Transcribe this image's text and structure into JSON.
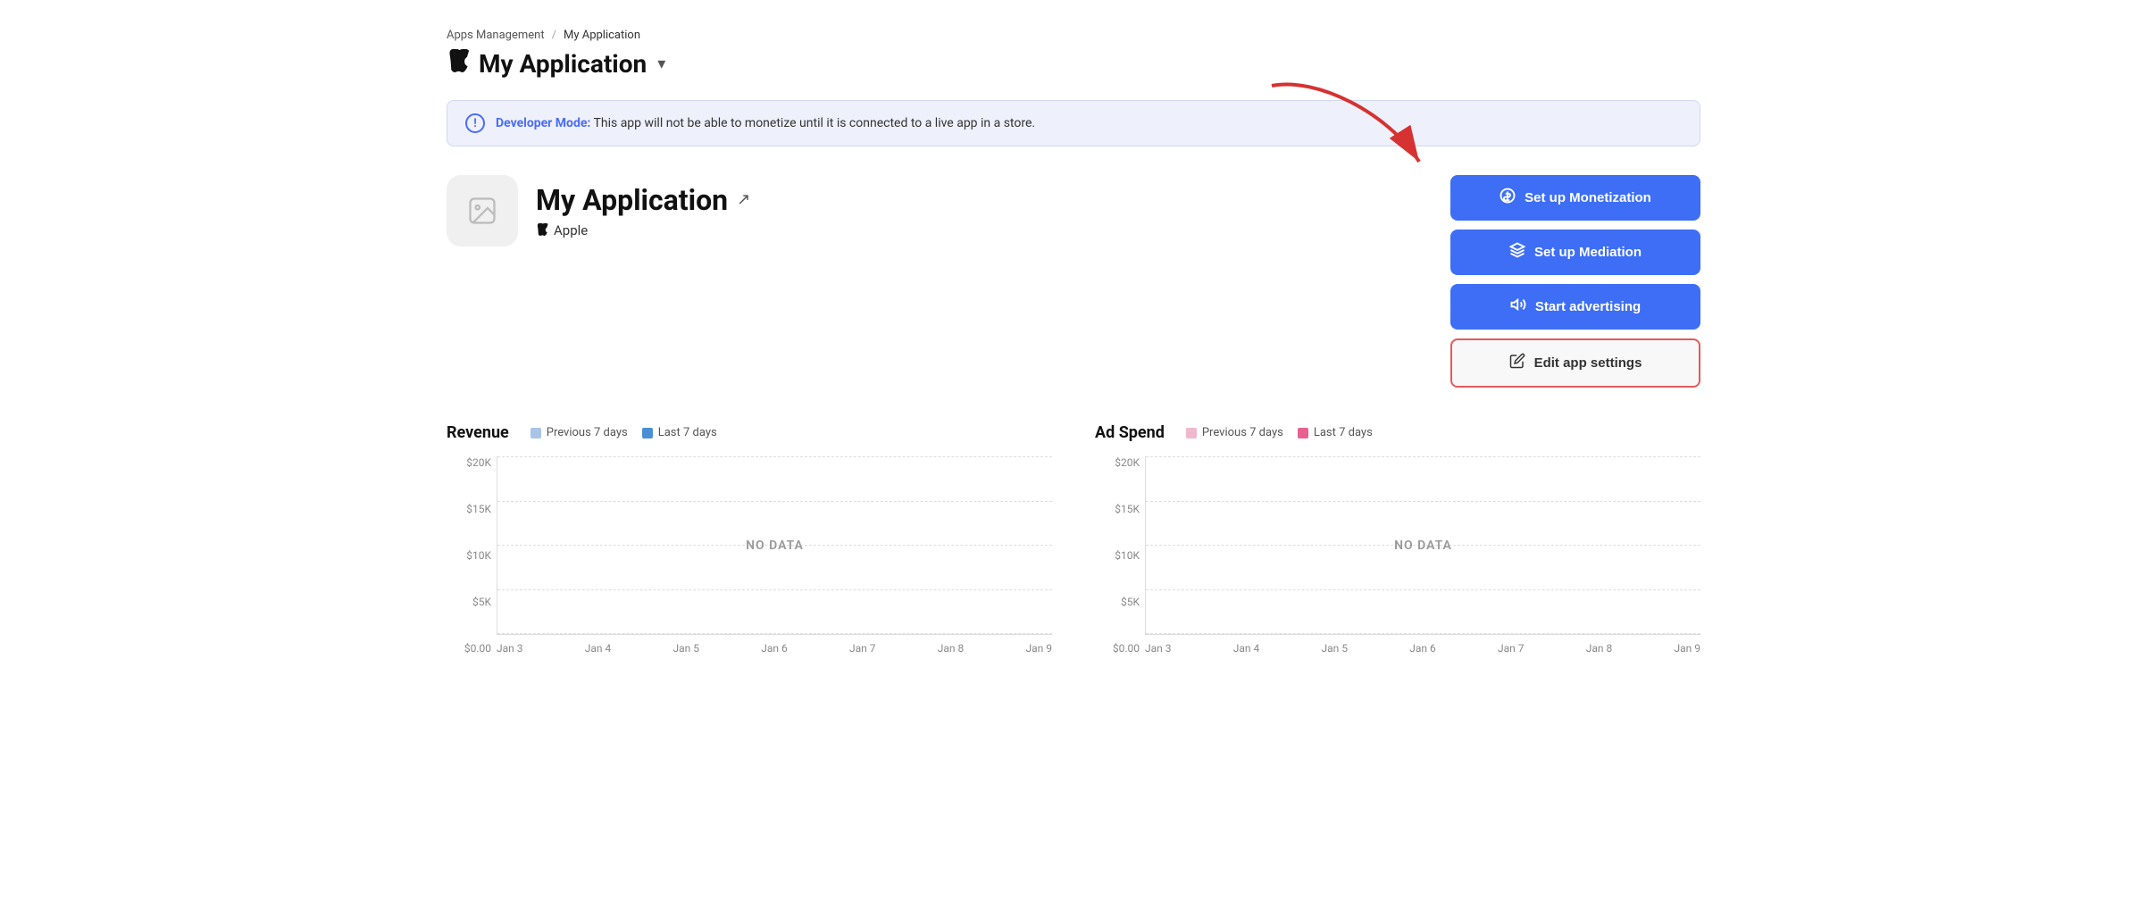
{
  "breadcrumb": {
    "parent_label": "Apps Management",
    "separator": "/",
    "current_label": "My Application"
  },
  "page_title": {
    "icon": "🍎",
    "text": "My Application",
    "chevron": "▾"
  },
  "dev_banner": {
    "icon_text": "!",
    "bold_label": "Developer Mode:",
    "message": " This app will not be able to monetize until it is connected to a live app in a store."
  },
  "app": {
    "name": "My Application",
    "store": "Apple",
    "external_link_icon": "↗"
  },
  "buttons": {
    "monetization_label": "Set up Monetization",
    "mediation_label": "Set up Mediation",
    "advertising_label": "Start advertising",
    "edit_settings_label": "Edit app settings"
  },
  "revenue_chart": {
    "title": "Revenue",
    "legend": [
      {
        "label": "Previous 7 days",
        "color": "#a8c4e8"
      },
      {
        "label": "Last 7 days",
        "color": "#4a8fd4"
      }
    ],
    "y_labels": [
      "$20K",
      "$15K",
      "$10K",
      "$5K",
      "$0.00"
    ],
    "x_labels": [
      "Jan 3",
      "Jan 4",
      "Jan 5",
      "Jan 6",
      "Jan 7",
      "Jan 8",
      "Jan 9"
    ],
    "no_data_text": "NO DATA"
  },
  "adspend_chart": {
    "title": "Ad Spend",
    "legend": [
      {
        "label": "Previous 7 days",
        "color": "#f0b8cc"
      },
      {
        "label": "Last 7 days",
        "color": "#e86090"
      }
    ],
    "y_labels": [
      "$20K",
      "$15K",
      "$10K",
      "$5K",
      "$0.00"
    ],
    "x_labels": [
      "Jan 3",
      "Jan 4",
      "Jan 5",
      "Jan 6",
      "Jan 7",
      "Jan 8",
      "Jan 9"
    ],
    "no_data_text": "NO DATA"
  },
  "colors": {
    "primary_blue": "#3d6ef5",
    "edit_border": "#e05c5c",
    "banner_bg": "#eef1fb"
  }
}
